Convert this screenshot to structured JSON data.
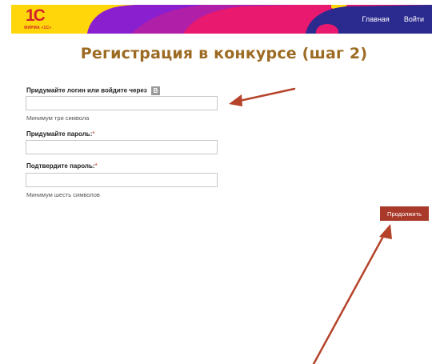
{
  "header": {
    "logo": {
      "mark": "1С",
      "subtext": "ФИРМА «1С»"
    },
    "nav": [
      {
        "label": "Главная"
      },
      {
        "label": "Войти"
      }
    ]
  },
  "page": {
    "title": "Регистрация в конкурсе (шаг 2)"
  },
  "form": {
    "login": {
      "label": "Придумайте логин или войдите через",
      "vk_icon_text": "B",
      "value": "",
      "hint": "Минимум три символа"
    },
    "password": {
      "label": "Придумайте пароль:",
      "required_mark": "*",
      "value": ""
    },
    "password_confirm": {
      "label": "Подтвердите пароль:",
      "required_mark": "*",
      "value": "",
      "hint": "Минимум шесть символов"
    },
    "submit_label": "Продолжить"
  },
  "colors": {
    "header_yellow": "#ffd60a",
    "header_purple": "#8a1fd0",
    "header_pink": "#e8196e",
    "header_navy": "#2b2a8f",
    "title": "#9c6a22",
    "button": "#a93a2a",
    "annotation_arrow": "#b5432a",
    "required_mark": "#c0392b"
  }
}
